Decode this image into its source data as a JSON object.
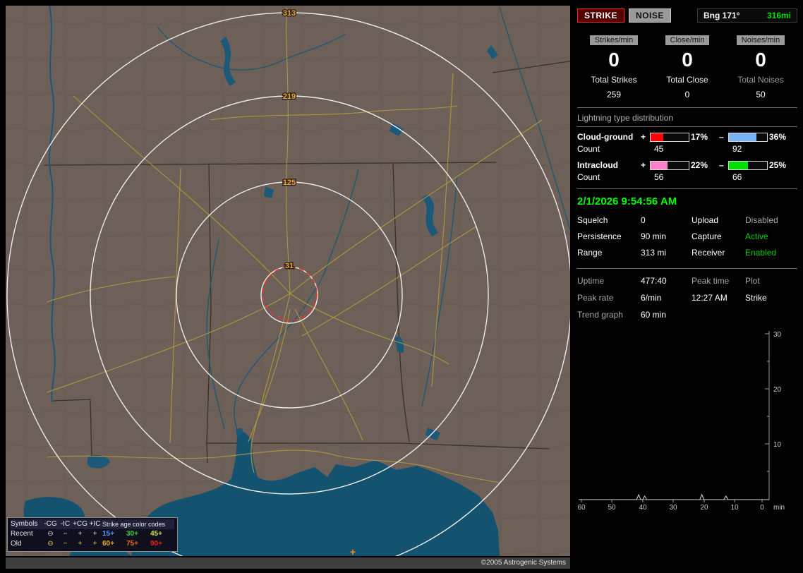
{
  "map": {
    "ring_labels": [
      "313",
      "219",
      "125",
      "31"
    ],
    "strike_marker": "+",
    "legend": {
      "symbols_title": "Symbols",
      "columns": [
        "-CG",
        "-IC",
        "+CG",
        "+IC"
      ],
      "age_title": "Strike age color codes",
      "rows": [
        {
          "label": "Recent",
          "sym_color": "#d8d8d8",
          "symbols": [
            "⊖",
            "−",
            "+",
            "+"
          ],
          "ages": [
            {
              "text": "15+",
              "color": "#4f9bff"
            },
            {
              "text": "30+",
              "color": "#3ecf3e"
            },
            {
              "text": "45+",
              "color": "#cde03a"
            }
          ]
        },
        {
          "label": "Old",
          "sym_color": "#e8d44c",
          "symbols": [
            "⊖",
            "−",
            "+",
            "+"
          ],
          "ages": [
            {
              "text": "60+",
              "color": "#f5b020"
            },
            {
              "text": "75+",
              "color": "#f07018"
            },
            {
              "text": "90+",
              "color": "#f02010"
            }
          ]
        }
      ]
    },
    "copyright": "©2005 Astrogenic Systems"
  },
  "panel": {
    "strike_button": "STRIKE",
    "noise_button": "NOISE",
    "bearing_label": "Bng 171°",
    "bearing_range": "316mi",
    "rate_columns": [
      {
        "chip": "Strikes/min",
        "rate": "0",
        "total_label": "Total Strikes",
        "total_label_color": "#f0f0f0",
        "total": "259"
      },
      {
        "chip": "Close/min",
        "rate": "0",
        "total_label": "Total Close",
        "total_label_color": "#f0f0f0",
        "total": "0"
      },
      {
        "chip": "Noises/min",
        "rate": "0",
        "total_label": "Total Noises",
        "total_label_color": "#9a9a9a",
        "total": "50"
      }
    ],
    "distribution": {
      "title": "Lightning type distribution",
      "plus": "+",
      "minus": "–",
      "rows": [
        {
          "name": "Cloud-ground",
          "count_label": "Count",
          "pos_val": 17,
          "pos_pct": "17%",
          "pos_color": "#ff0000",
          "pos_count": "45",
          "neg_val": 36,
          "neg_pct": "36%",
          "neg_color": "#7ab4f5",
          "neg_count": "92"
        },
        {
          "name": "Intracloud",
          "count_label": "Count",
          "pos_val": 22,
          "pos_pct": "22%",
          "pos_color": "#ff80c8",
          "pos_count": "56",
          "neg_val": 25,
          "neg_pct": "25%",
          "neg_color": "#00dd00",
          "neg_count": "66"
        }
      ]
    },
    "datetime": "2/1/2026 9:54:56 AM",
    "status_rows": [
      {
        "l1": "Squelch",
        "v1": "0",
        "l2": "Upload",
        "v2": "Disabled",
        "v2_color": "#a8a8a8"
      },
      {
        "l1": "Persistence",
        "v1": "90 min",
        "l2": "Capture",
        "v2": "Active",
        "v2_color": "#00cc00"
      },
      {
        "l1": "Range",
        "v1": "313 mi",
        "l2": "Receiver",
        "v2": "Enabled",
        "v2_color": "#00cc00"
      }
    ],
    "stats": {
      "uptime_label": "Uptime",
      "uptime": "477:40",
      "peaktime_label": "Peak time",
      "plot_label": "Plot",
      "peakrate_label": "Peak rate",
      "peakrate": "6/min",
      "peaktime": "12:27 AM",
      "plot": "Strike",
      "trend_label": "Trend graph",
      "trend_value": "60 min"
    },
    "trend": {
      "type": "line",
      "title": "Strike rate trend",
      "ylim": [
        0,
        30
      ],
      "y_ticks": [
        "30",
        "20",
        "10"
      ],
      "x_ticks": [
        "60",
        "50",
        "40",
        "30",
        "20",
        "10",
        "0"
      ],
      "unit": "min",
      "spikes": [
        {
          "min": 41,
          "h": 7
        },
        {
          "min": 39,
          "h": 5
        },
        {
          "min": 20,
          "h": 7
        },
        {
          "min": 12,
          "h": 5
        }
      ]
    }
  }
}
